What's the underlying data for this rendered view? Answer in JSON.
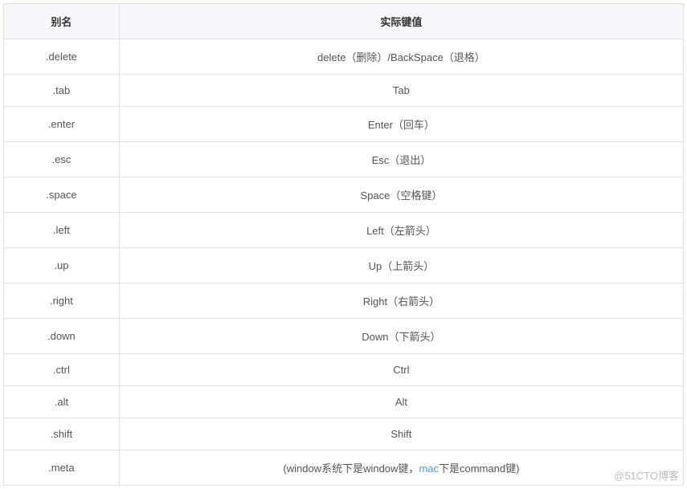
{
  "table": {
    "headers": {
      "alias": "别名",
      "value": "实际键值"
    },
    "rows": [
      {
        "alias": ".delete",
        "value": "delete（删除）/BackSpace（退格）"
      },
      {
        "alias": ".tab",
        "value": "Tab"
      },
      {
        "alias": ".enter",
        "value": "Enter（回车）"
      },
      {
        "alias": ".esc",
        "value": "Esc（退出）"
      },
      {
        "alias": ".space",
        "value": "Space（空格键）"
      },
      {
        "alias": ".left",
        "value": "Left（左箭头）"
      },
      {
        "alias": ".up",
        "value": "Up（上箭头）"
      },
      {
        "alias": ".right",
        "value": "Right（右箭头）"
      },
      {
        "alias": ".down",
        "value": "Down（下箭头）"
      },
      {
        "alias": ".ctrl",
        "value": "Ctrl"
      },
      {
        "alias": ".alt",
        "value": "Alt"
      },
      {
        "alias": ".shift",
        "value": "Shift"
      }
    ],
    "meta_row": {
      "alias": ".meta",
      "prefix": "(window系统下是window键，",
      "link": "mac",
      "suffix": "下是command键)"
    }
  },
  "watermark": "@51CTO博客"
}
